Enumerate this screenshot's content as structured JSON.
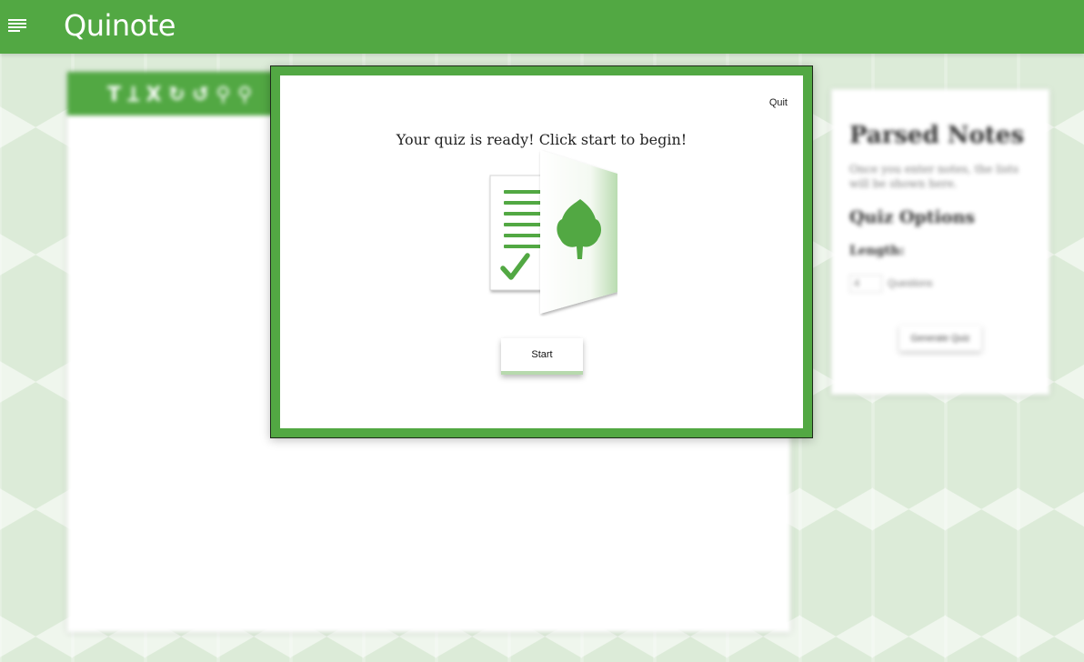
{
  "app": {
    "logo": "Quinote"
  },
  "editor": {
    "toolbar_glyphs": "T Ʇ X ↻ ↺ ⚲ ⚲"
  },
  "sidebar": {
    "title": "Parsed Notes",
    "hint": "Once you enter notes, the lists will be shown here.",
    "options_title": "Quiz Options",
    "length_label": "Length:",
    "length_value": "4",
    "questions_label": "Questions",
    "generate_label": "Generate Quiz"
  },
  "modal": {
    "quit_label": "Quit",
    "title": "Your quiz is ready! Click start to begin!",
    "start_label": "Start"
  },
  "colors": {
    "brand_green": "#52a843",
    "background": "#dcebd8"
  },
  "icons": [
    "menu-icon",
    "quiz-document-icon",
    "checkmark-icon",
    "leaf-icon"
  ]
}
